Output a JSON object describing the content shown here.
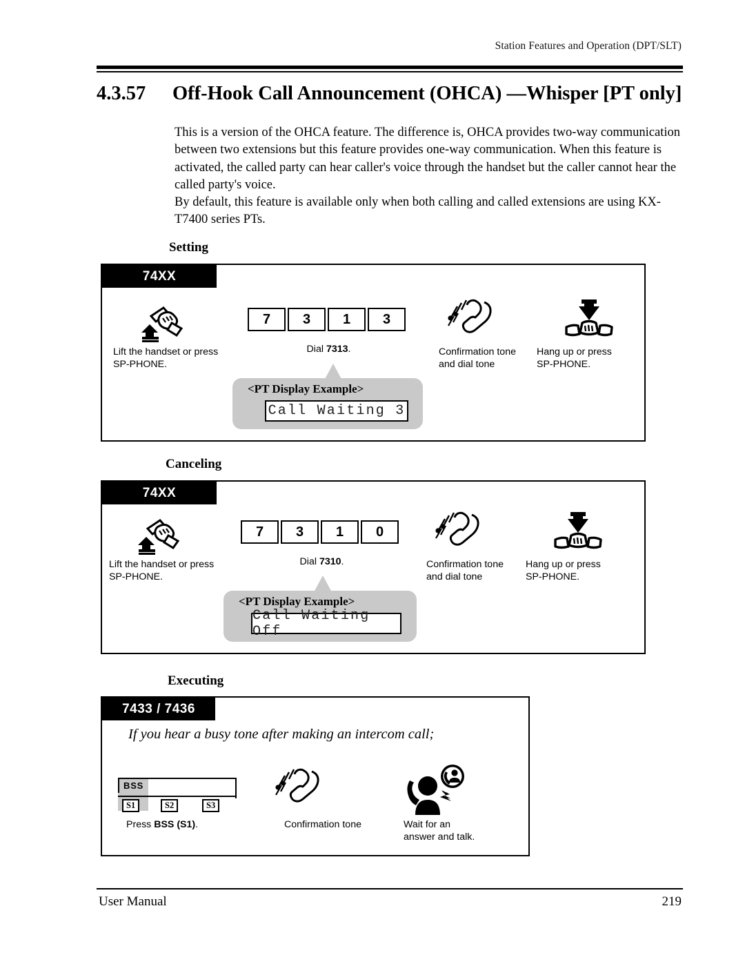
{
  "header": {
    "running_head": "Station Features and Operation (DPT/SLT)"
  },
  "section": {
    "number": "4.3.57",
    "title": "Off-Hook Call Announcement (OHCA) —Whisper [PT only]"
  },
  "body": {
    "paragraph_1": "This is a version of the OHCA feature. The difference is, OHCA provides two-way communication between two extensions but this feature provides one-way communication. When this feature is activated, the called party can hear caller's voice through the handset but the caller cannot hear the called party's voice.",
    "paragraph_2": " By default, this feature is available only when both calling and called extensions are using KX-T7400 series PTs."
  },
  "diagrams": [
    {
      "label": "Setting",
      "code_tab": "74XX",
      "steps": [
        {
          "icon": "lift-handset-icon",
          "caption": "Lift the handset or press\nSP-PHONE."
        },
        {
          "icon": "dial-keys",
          "keys": [
            "7",
            "3",
            "1",
            "3"
          ],
          "caption_prefix": "Dial ",
          "caption_code": "7313",
          "caption_suffix": "."
        },
        {
          "icon": "confirmation-tone-icon",
          "caption": "Confirmation tone\nand dial tone"
        },
        {
          "icon": "hang-up-icon",
          "caption": "Hang up or press\nSP-PHONE."
        }
      ],
      "callout": {
        "title": "<PT Display Example>",
        "lcd_text": "Call Waiting 3"
      }
    },
    {
      "label": "Canceling",
      "code_tab": "74XX",
      "steps": [
        {
          "icon": "lift-handset-icon",
          "caption": "Lift the handset or press\nSP-PHONE."
        },
        {
          "icon": "dial-keys",
          "keys": [
            "7",
            "3",
            "1",
            "0"
          ],
          "caption_prefix": "Dial ",
          "caption_code": "7310",
          "caption_suffix": "."
        },
        {
          "icon": "confirmation-tone-icon",
          "caption": "Confirmation tone\nand dial tone"
        },
        {
          "icon": "hang-up-icon",
          "caption": "Hang up or press\nSP-PHONE."
        }
      ],
      "callout": {
        "title": "<PT Display Example>",
        "lcd_text": "Call Waiting Off"
      }
    },
    {
      "label": "Executing",
      "code_tab": "7433 / 7436",
      "note": "If you hear a busy tone after making an intercom call;",
      "softkeys": {
        "bss_label": "BSS",
        "keys": [
          "S1",
          "S2",
          "S3"
        ],
        "selected": "S1"
      },
      "steps": [
        {
          "icon": "bss-softkey-icon",
          "caption_prefix": "Press ",
          "caption_code": "BSS (S1)",
          "caption_suffix": "."
        },
        {
          "icon": "confirmation-tone-icon",
          "caption": "Confirmation tone"
        },
        {
          "icon": "wait-answer-talk-icon",
          "caption": "Wait for an\nanswer and talk."
        }
      ]
    }
  ],
  "footer": {
    "left": "User Manual",
    "page_number": "219"
  },
  "colors": {
    "ink": "#000000",
    "callout_gray": "#c9c9c9",
    "paper": "#ffffff"
  }
}
